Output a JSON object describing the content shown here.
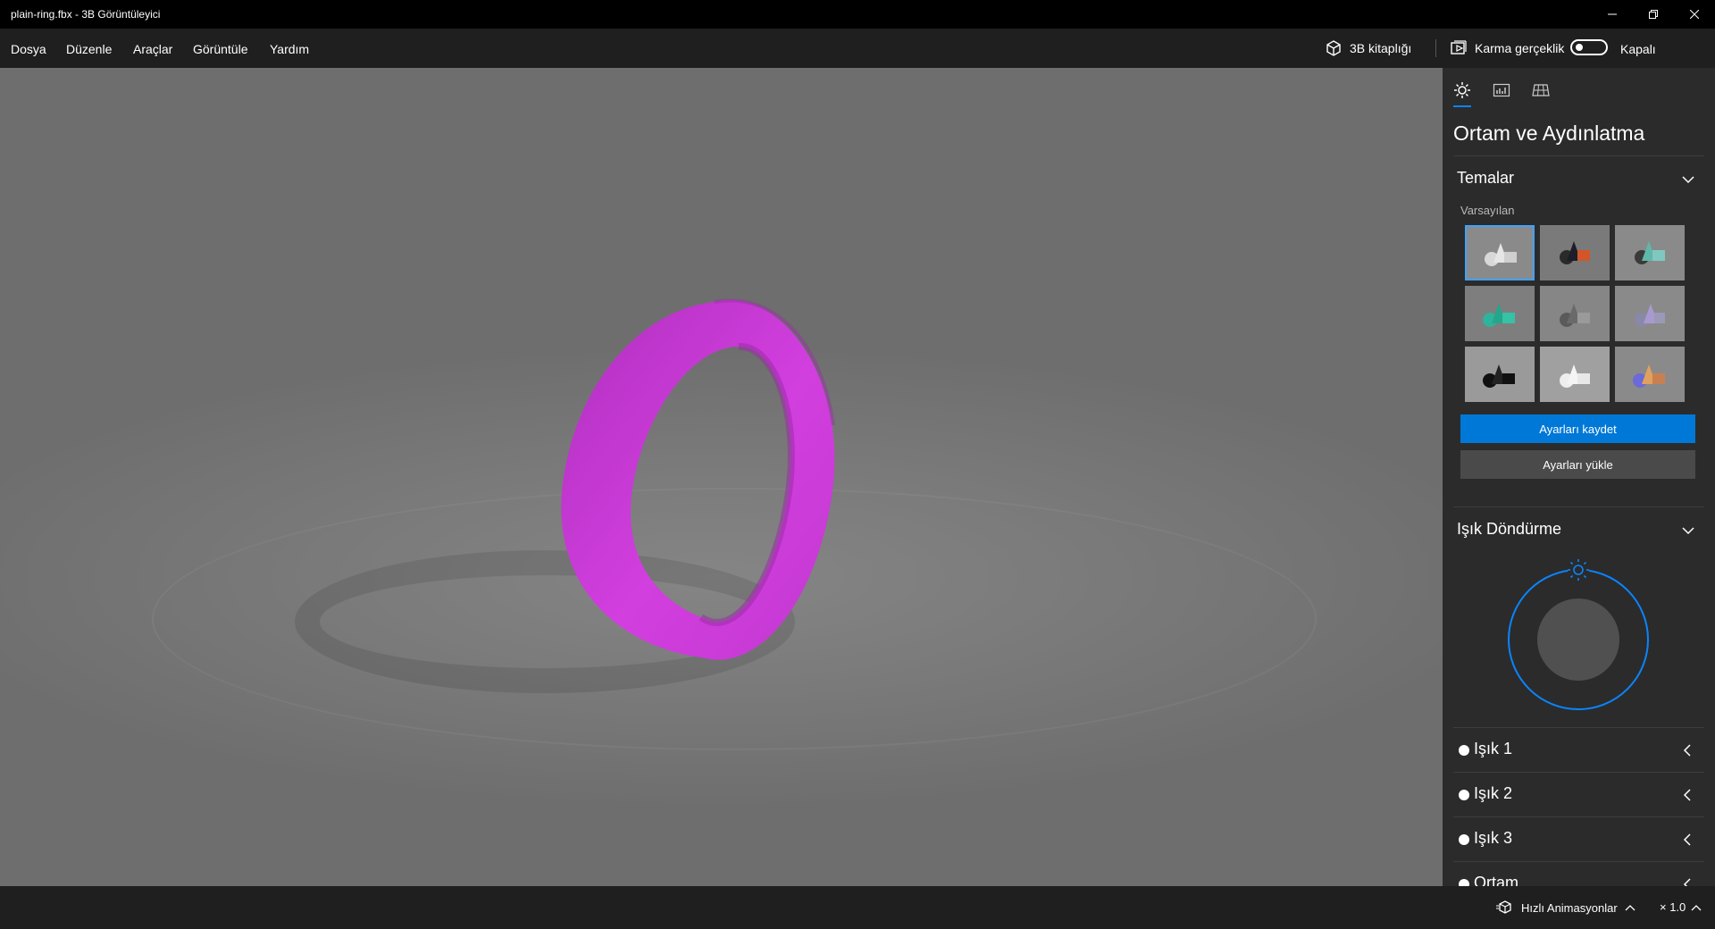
{
  "window": {
    "title": "plain-ring.fbx - 3B Görüntüleyici",
    "controls": [
      "minimize",
      "restore",
      "close"
    ]
  },
  "menu": {
    "items": [
      "Dosya",
      "Düzenle",
      "Araçlar",
      "Görüntüle",
      "Yardım"
    ],
    "library_label": "3B kitaplığı",
    "mixed_reality_label": "Karma gerçeklik",
    "mixed_reality_state": "Kapalı",
    "mixed_reality_on": false
  },
  "viewport": {
    "background": "#7a7a7a",
    "model_color": "#c93ad6"
  },
  "panel": {
    "tabs": [
      "sun-icon",
      "chart-icon",
      "grid-icon"
    ],
    "active_tab": 0,
    "title": "Ortam ve Aydınlatma",
    "themes_section": {
      "title": "Temalar",
      "subtitle": "Varsayılan",
      "selected_index": 0,
      "themes": [
        {
          "name": "theme-default-white",
          "accent": "#d0d0d0"
        },
        {
          "name": "theme-dark-orange",
          "accent": "#d2562a"
        },
        {
          "name": "theme-teal-dark",
          "accent": "#5fb8a8"
        },
        {
          "name": "theme-green",
          "accent": "#2fb39a"
        },
        {
          "name": "theme-grey",
          "accent": "#9a9a9a"
        },
        {
          "name": "theme-lavender",
          "accent": "#a89ad0"
        },
        {
          "name": "theme-black",
          "accent": "#111111"
        },
        {
          "name": "theme-white",
          "accent": "#eeeeee"
        },
        {
          "name": "theme-violet-orange",
          "accent": "#8a6ad0"
        }
      ],
      "save_label": "Ayarları kaydet",
      "load_label": "Ayarları yükle"
    },
    "rotation_section": {
      "title": "Işık Döndürme",
      "accent": "#0a84ff"
    },
    "lights": [
      {
        "label": "Işık 1"
      },
      {
        "label": "Işık 2"
      },
      {
        "label": "Işık 3"
      },
      {
        "label": "Ortam"
      }
    ]
  },
  "statusbar": {
    "animations_label": "Hızlı Animasyonlar",
    "speed_label": "× 1.0"
  }
}
